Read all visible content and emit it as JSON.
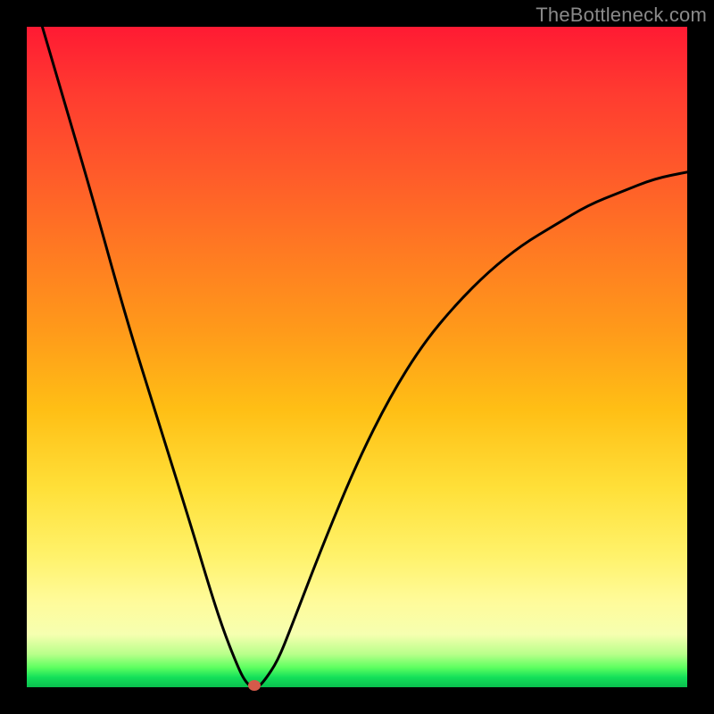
{
  "watermark": "TheBottleneck.com",
  "chart_data": {
    "type": "line",
    "title": "",
    "xlabel": "",
    "ylabel": "",
    "xlim": [
      0,
      100
    ],
    "ylim": [
      0,
      100
    ],
    "x": [
      0,
      5,
      10,
      15,
      20,
      25,
      28,
      30,
      32,
      33,
      34,
      35,
      36,
      38,
      40,
      45,
      50,
      55,
      60,
      65,
      70,
      75,
      80,
      85,
      90,
      95,
      100
    ],
    "y": [
      108,
      91,
      74,
      56,
      40,
      24,
      14,
      8,
      3,
      1,
      0,
      0,
      1,
      4,
      9,
      22,
      34,
      44,
      52,
      58,
      63,
      67,
      70,
      73,
      75,
      77,
      78
    ],
    "minimum_point": {
      "x": 34.5,
      "y": 0
    },
    "grid": false,
    "legend": false
  },
  "colors": {
    "curve": "#000000",
    "dot": "#d65a4a",
    "watermark": "#8a8a8a"
  }
}
